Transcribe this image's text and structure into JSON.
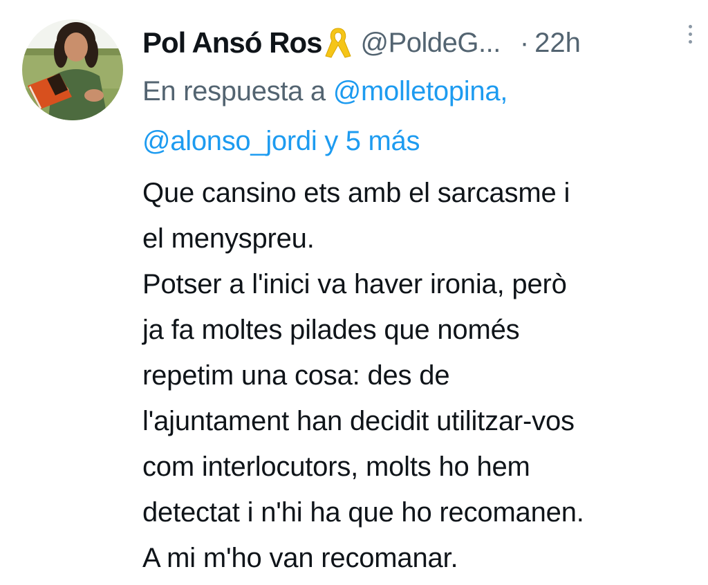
{
  "tweet": {
    "display_name": "Pol Ansó Ros",
    "badge_icon": "yellow-ribbon-icon",
    "badge_color": "#f5c518",
    "handle": "@PoldeG...",
    "separator": "·",
    "time": "22h",
    "more_icon": "vertical-ellipsis-icon",
    "reply": {
      "prefix": "En respuesta a ",
      "mention_1": "@molletopina,",
      "mention_2": "@alonso_jordi",
      "joiner": " y ",
      "others": "5 más"
    },
    "body_lines": [
      "Que cansino ets amb el sarcasme i",
      "el menyspreu.",
      "Potser a l'inici va haver ironia, però",
      "ja fa moltes pilades que només",
      "repetim una cosa: des de",
      "l'ajuntament han decidit utilitzar-vos",
      "com interlocutors, molts ho hem",
      "detectat i n'hi ha que ho recomanen.",
      "A mi m'ho van recomanar."
    ]
  },
  "colors": {
    "text": "#0f1419",
    "secondary": "#536471",
    "link": "#1d9bf0"
  }
}
